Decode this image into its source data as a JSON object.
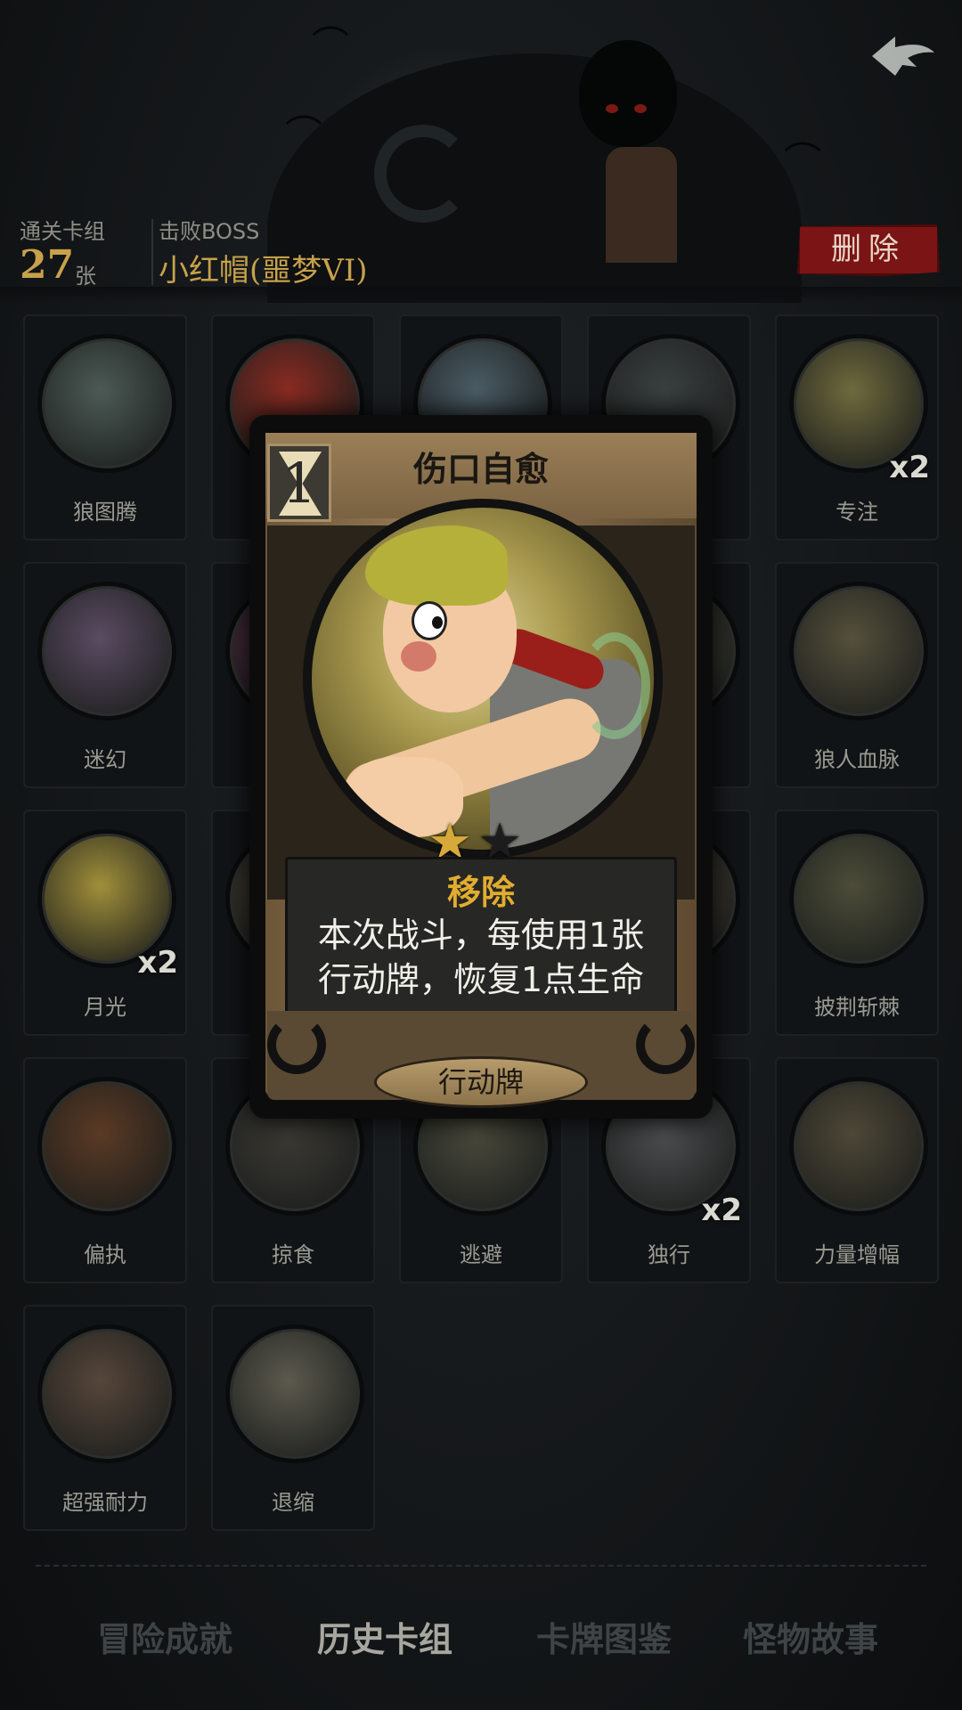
{
  "header": {
    "cleared_deck_label": "通关卡组",
    "cleared_deck_count": "27",
    "cleared_deck_unit": "张",
    "defeated_boss_label": "击败BOSS",
    "defeated_boss_name": "小红帽(噩梦VI)",
    "delete_button": "删除",
    "back_icon": "back-arrow-icon"
  },
  "cards": [
    {
      "name": "狼图腾",
      "qty": ""
    },
    {
      "name": "",
      "qty": ""
    },
    {
      "name": "",
      "qty": ""
    },
    {
      "name": "",
      "qty": ""
    },
    {
      "name": "专注",
      "qty": "x2"
    },
    {
      "name": "迷幻",
      "qty": ""
    },
    {
      "name": "",
      "qty": ""
    },
    {
      "name": "",
      "qty": ""
    },
    {
      "name": "",
      "qty": ""
    },
    {
      "name": "狼人血脉",
      "qty": ""
    },
    {
      "name": "月光",
      "qty": "x2"
    },
    {
      "name": "",
      "qty": ""
    },
    {
      "name": "",
      "qty": ""
    },
    {
      "name": "",
      "qty": ""
    },
    {
      "name": "披荆斩棘",
      "qty": ""
    },
    {
      "name": "偏执",
      "qty": ""
    },
    {
      "name": "掠食",
      "qty": ""
    },
    {
      "name": "逃避",
      "qty": ""
    },
    {
      "name": "独行",
      "qty": "x2"
    },
    {
      "name": "力量增幅",
      "qty": ""
    },
    {
      "name": "超强耐力",
      "qty": ""
    },
    {
      "name": "退缩",
      "qty": ""
    }
  ],
  "card_colors": [
    "#4c5a55",
    "#8a2b22",
    "#4b5d66",
    "#3a4040",
    "#6f6a3d",
    "#5a4b62",
    "#5a2f4a",
    "#3c4650",
    "#4a4a3a",
    "#55503b",
    "#a08f3a",
    "#4a4436",
    "#4e4a30",
    "#514838",
    "#4c4c38",
    "#5a3a24",
    "#3c3a34",
    "#4a4a3c",
    "#4c4e50",
    "#4d4736",
    "#56463a",
    "#5c5a4e"
  ],
  "popup_card": {
    "cost": "1",
    "cost_icon": "hourglass-icon",
    "title": "伤口自愈",
    "stars_filled": 1,
    "stars_total": 2,
    "keyword": "移除",
    "description_line1": "本次战斗，每使用1张",
    "description_line2": "行动牌，恢复1点生命",
    "type": "行动牌"
  },
  "tabs": [
    {
      "label": "冒险成就",
      "active": false
    },
    {
      "label": "历史卡组",
      "active": true
    },
    {
      "label": "卡牌图鉴",
      "active": false
    },
    {
      "label": "怪物故事",
      "active": false
    }
  ]
}
